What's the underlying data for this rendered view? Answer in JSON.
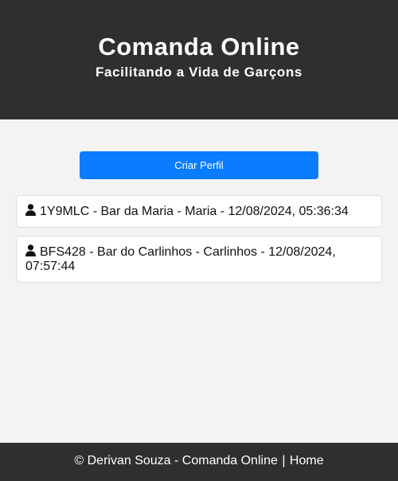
{
  "header": {
    "title": "Comanda Online",
    "subtitle": "Facilitando a Vida de Garçons"
  },
  "main": {
    "create_profile_label": "Criar Perfil",
    "profiles": [
      {
        "icon": "user-icon",
        "text": "1Y9MLC - Bar da Maria - Maria - 12/08/2024, 05:36:34"
      },
      {
        "icon": "user-icon",
        "text": "BFS428 - Bar do Carlinhos - Carlinhos - 12/08/2024, 07:57:44"
      }
    ]
  },
  "footer": {
    "credit": "© Derivan Souza - Comanda Online",
    "separator": "|",
    "home_link": "Home"
  },
  "colors": {
    "header_bg": "#2f2f2f",
    "page_bg": "#f3f3f3",
    "accent": "#0a7cff"
  }
}
